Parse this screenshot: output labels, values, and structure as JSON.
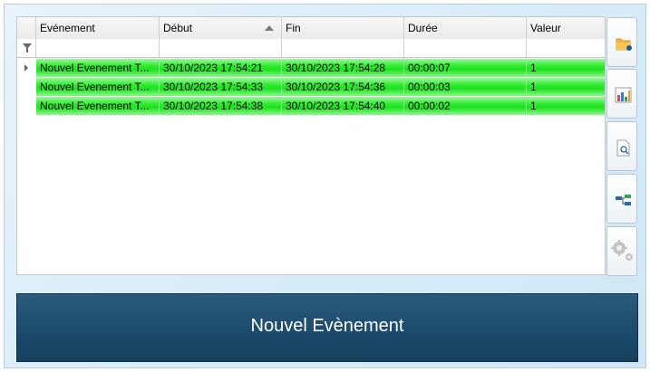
{
  "grid": {
    "columns": [
      {
        "key": "event",
        "label": "Evénement"
      },
      {
        "key": "start",
        "label": "Début"
      },
      {
        "key": "end",
        "label": "Fin"
      },
      {
        "key": "duration",
        "label": "Durée"
      },
      {
        "key": "value",
        "label": "Valeur"
      }
    ],
    "sorted_column": "start",
    "sort_direction": "ascending",
    "row_color": "#2eea2e",
    "rows": [
      {
        "event": "Nouvel Evenement T...",
        "start": "30/10/2023 17:54:21",
        "end": "30/10/2023 17:54:28",
        "duration": "00:00:07",
        "value": "1"
      },
      {
        "event": "Nouvel Evenement T...",
        "start": "30/10/2023 17:54:33",
        "end": "30/10/2023 17:54:36",
        "duration": "00:00:03",
        "value": "1"
      },
      {
        "event": "Nouvel Evenement T...",
        "start": "30/10/2023 17:54:38",
        "end": "30/10/2023 17:54:40",
        "duration": "00:00:02",
        "value": "1"
      }
    ]
  },
  "toolbar": {
    "buttons": [
      {
        "icon": "folder-icon"
      },
      {
        "icon": "bar-chart-icon"
      },
      {
        "icon": "document-search-icon"
      },
      {
        "icon": "flow-icon"
      },
      {
        "icon": "gears-icon",
        "disabled": true
      }
    ]
  },
  "banner": {
    "label": "Nouvel Evènement",
    "color": "#1b4a6c"
  }
}
